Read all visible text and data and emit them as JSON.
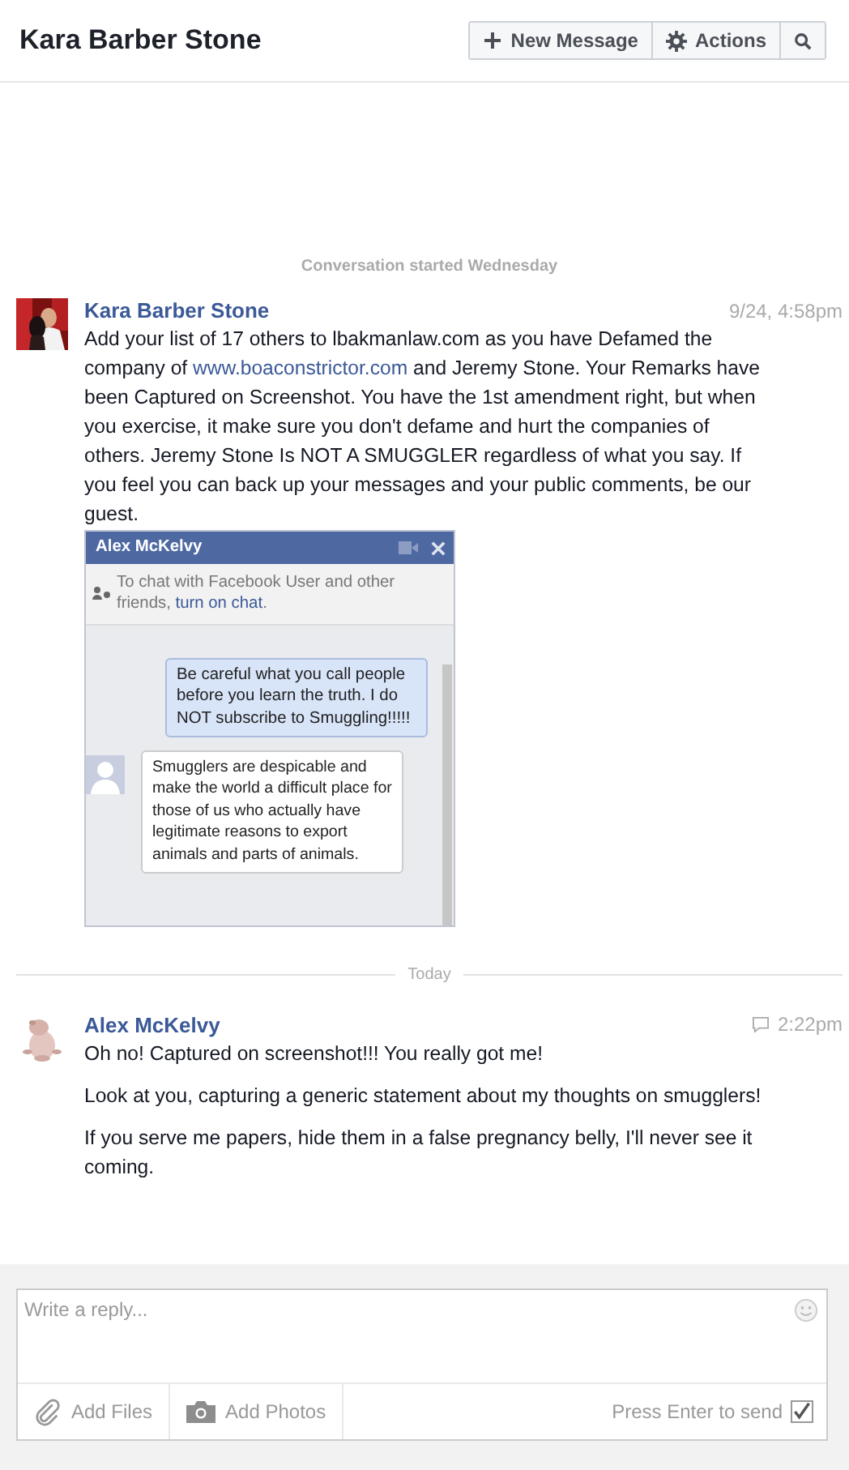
{
  "header": {
    "title": "Kara Barber Stone",
    "buttons": [
      {
        "label": "New Message",
        "kind": "compose"
      },
      {
        "label": "Actions",
        "kind": "actions"
      },
      {
        "kind": "search"
      }
    ]
  },
  "conversation_start": "Conversation started Wednesday",
  "messages": [
    {
      "kind": "message",
      "author": "Kara Barber Stone",
      "time": "9/24, 4:58pm",
      "avatar": {
        "kind": "picture"
      },
      "paragraphs": [
        [
          {
            "text": "Add your list of 17 others to lbakmanlaw.com as you have Defamed the company of "
          },
          {
            "text": "www.boaconstrictor.com",
            "kind": "link"
          },
          {
            "text": " and Jeremy Stone. Your Remarks have been Captured on Screenshot.  You have the 1st amendment right, but when you exercise, it make sure you don't defame and hurt the companies of others.  Jeremy Stone Is NOT A SMUGGLER regardless of what you say. If you feel you can back up your messages and your public comments, be our guest."
          }
        ]
      ],
      "attachment": {
        "title": "Alex McKelvy",
        "notice": "To chat with Facebook User and other friends, ",
        "notice_link": "turn on chat",
        "notice_end": ".",
        "bubbles": [
          {
            "kind": "outgoing",
            "text": "Be careful what you call people before you learn the truth. I do NOT subscribe to Smuggling!!!!!"
          },
          {
            "kind": "incoming",
            "text": "Smugglers are despicable and make the world a difficult place for those of us who actually have legitimate reasons to export animals and parts of animals."
          }
        ]
      }
    },
    {
      "kind": "chat_message",
      "divider": "Today",
      "author": "Alex McKelvy",
      "time": "2:22pm",
      "avatar": {
        "kind": "picture"
      },
      "paragraphs": [
        [
          {
            "text": "Oh no! Captured on screenshot!!! You really got me!"
          }
        ],
        [
          {
            "text": "Look at you, capturing a generic statement about my thoughts on smugglers!"
          }
        ],
        [
          {
            "text": "If you serve me papers, hide them in a false pregnancy belly, I'll never see it coming."
          }
        ]
      ]
    }
  ],
  "composer": {
    "placeholder": "Write a reply...",
    "actions": [
      {
        "label": "Add Files",
        "kind": "files"
      },
      {
        "label": "Add Photos",
        "kind": "photos"
      }
    ],
    "send_hint": "Press Enter to send",
    "enter_to_send": {
      "checked": true
    }
  }
}
